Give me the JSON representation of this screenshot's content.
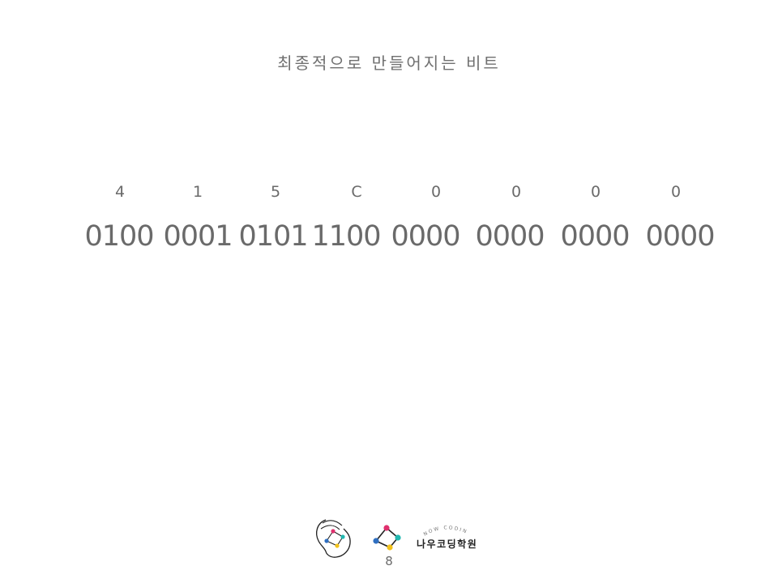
{
  "slide": {
    "title": "최종적으로 만들어지는 비트",
    "hex_digits": [
      "4",
      "1",
      "5",
      "C",
      "0",
      "0",
      "0",
      "0"
    ],
    "binary_groups": [
      "0100",
      "0001",
      "0101",
      "1100",
      "0000",
      "0000",
      "0000",
      "0000"
    ],
    "page_number": "8"
  },
  "logo": {
    "tagline": "NOW CODING",
    "name": "나우코딩학원",
    "icon": "network-diamond-icon",
    "colors": {
      "magenta": "#e0306e",
      "teal": "#21b8b0",
      "yellow": "#f2c21b",
      "blue": "#2f6fc0",
      "dark": "#222222"
    }
  }
}
